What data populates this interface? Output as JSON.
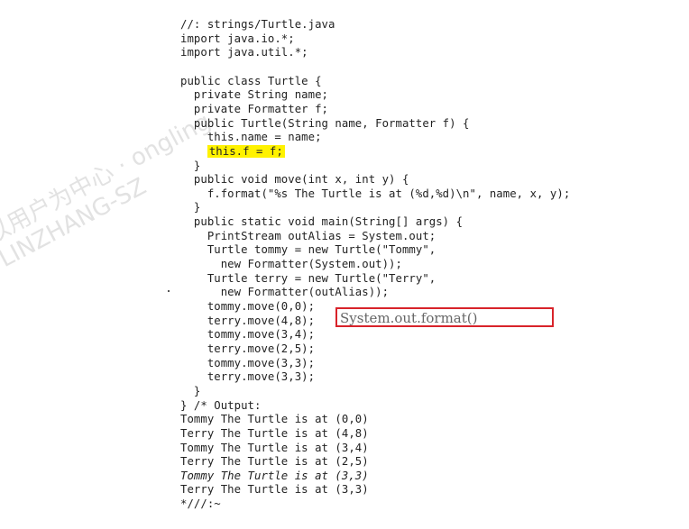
{
  "code_lines": [
    "//: strings/Turtle.java",
    "import java.io.*;",
    "import java.util.*;",
    "",
    "public class Turtle {",
    "  private String name;",
    "  private Formatter f;",
    "  public Turtle(String name, Formatter f) {",
    "    this.name = name;",
    "    this.f = f;",
    "  }",
    "  public void move(int x, int y) {",
    "    f.format(\"%s The Turtle is at (%d,%d)\\n\", name, x, y);",
    "  }",
    "  public static void main(String[] args) {",
    "    PrintStream outAlias = System.out;",
    "    Turtle tommy = new Turtle(\"Tommy\",",
    "      new Formatter(System.out));",
    "    Turtle terry = new Turtle(\"Terry\",",
    "      new Formatter(outAlias));",
    "    tommy.move(0,0);",
    "    terry.move(4,8);",
    "    tommy.move(3,4);",
    "    terry.move(2,5);",
    "    tommy.move(3,3);",
    "    terry.move(3,3);",
    "  }",
    "} /* Output:",
    "Tommy The Turtle is at (0,0)",
    "Terry The Turtle is at (4,8)",
    "Tommy The Turtle is at (3,4)",
    "Terry The Turtle is at (2,5)",
    "Tommy The Turtle is at (3,3)",
    "Terry The Turtle is at (3,3)",
    "*///:~"
  ],
  "highlight": {
    "line_index": 9,
    "indent": "    ",
    "text": "this.f = f;",
    "color": "#fff200"
  },
  "italic_line_index": 32,
  "annotation": {
    "text": "System.out.format()",
    "border_color": "#d8232a"
  },
  "watermark": {
    "line1": "以用户为中心  ·  ongling",
    "line2": "LINZHANG-SZ"
  }
}
